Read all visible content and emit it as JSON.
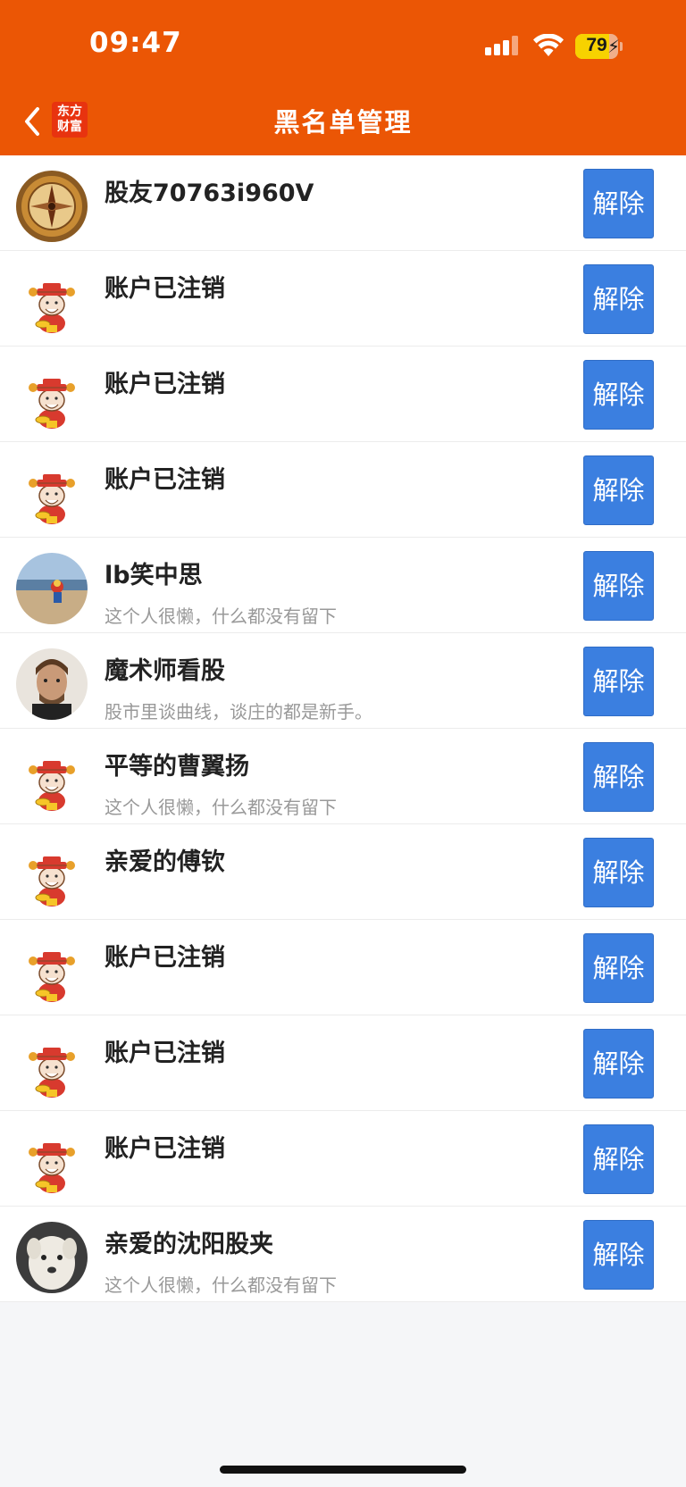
{
  "status_bar": {
    "time": "09:47",
    "battery_level": "79",
    "battery_percent": 79
  },
  "header": {
    "back_icon": "chevron-left-icon",
    "logo_line1": "东方",
    "logo_line2": "财富",
    "title": "黑名单管理",
    "background_color": "#eb5605"
  },
  "unblock_button_color": "#3b7fe0",
  "blocked_users": [
    {
      "name": "股友70763i960V",
      "bio": "",
      "avatar": "compass"
    },
    {
      "name": "账户已注销",
      "bio": "",
      "avatar": "caishen"
    },
    {
      "name": "账户已注销",
      "bio": "",
      "avatar": "caishen"
    },
    {
      "name": "账户已注销",
      "bio": "",
      "avatar": "caishen"
    },
    {
      "name": "lb笑中思",
      "bio": "这个人很懒，什么都没有留下",
      "avatar": "beach"
    },
    {
      "name": "魔术师看股",
      "bio": "股市里谈曲线，谈庄的都是新手。",
      "avatar": "portrait"
    },
    {
      "name": "平等的曹翼扬",
      "bio": "这个人很懒，什么都没有留下",
      "avatar": "caishen"
    },
    {
      "name": "亲爱的傅钦",
      "bio": "",
      "avatar": "caishen"
    },
    {
      "name": "账户已注销",
      "bio": "",
      "avatar": "caishen"
    },
    {
      "name": "账户已注销",
      "bio": "",
      "avatar": "caishen"
    },
    {
      "name": "账户已注销",
      "bio": "",
      "avatar": "caishen"
    },
    {
      "name": "亲爱的沈阳股夹",
      "bio": "这个人很懒，什么都没有留下",
      "avatar": "dog"
    }
  ],
  "unblock_label": "解除"
}
